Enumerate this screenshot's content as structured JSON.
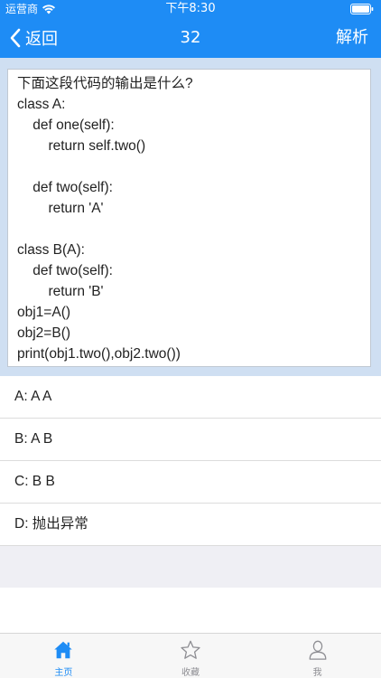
{
  "status_bar": {
    "carrier": "运营商",
    "time": "下午8:30"
  },
  "nav": {
    "back_label": "返回",
    "title": "32",
    "right_label": "解析"
  },
  "question": {
    "lines": [
      "下面这段代码的输出是什么?",
      "class A:",
      "    def one(self):",
      "        return self.two()",
      "",
      "    def two(self):",
      "        return 'A'",
      "",
      "class B(A):",
      "    def two(self):",
      "        return 'B'",
      "obj1=A()",
      "obj2=B()",
      "print(obj1.two(),obj2.two())"
    ]
  },
  "options": [
    {
      "label": "A:  A A"
    },
    {
      "label": "B:  A B"
    },
    {
      "label": "C:  B B"
    },
    {
      "label": "D:  抛出异常"
    }
  ],
  "tabs": [
    {
      "label": "主页",
      "icon": "home-icon",
      "active": true
    },
    {
      "label": "收藏",
      "icon": "star-icon",
      "active": false
    },
    {
      "label": "我",
      "icon": "user-icon",
      "active": false
    }
  ],
  "colors": {
    "primary": "#1e8cf5",
    "question_bg": "#cfdff2",
    "tab_inactive": "#8e8e93"
  }
}
